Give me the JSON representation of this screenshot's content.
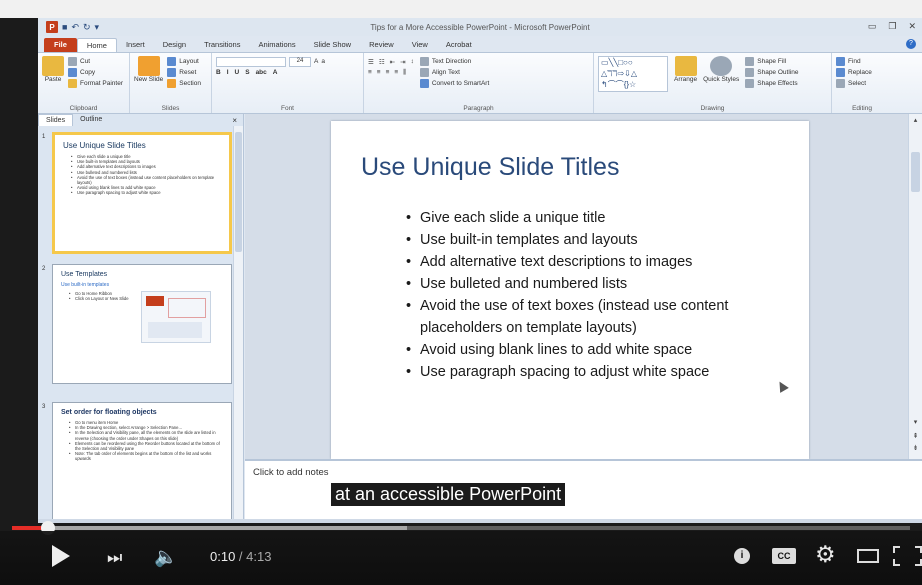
{
  "window": {
    "title": "Tips for a More Accessible PowerPoint - Microsoft PowerPoint",
    "logo": "P"
  },
  "tabs": [
    "File",
    "Home",
    "Insert",
    "Design",
    "Transitions",
    "Animations",
    "Slide Show",
    "Review",
    "View",
    "Acrobat"
  ],
  "ribbon": {
    "clipboard": {
      "paste": "Paste",
      "cut": "Cut",
      "copy": "Copy",
      "format_painter": "Format Painter",
      "label": "Clipboard"
    },
    "slides": {
      "new_slide": "New Slide",
      "layout": "Layout",
      "reset": "Reset",
      "section": "Section",
      "label": "Slides"
    },
    "font": {
      "size": "24",
      "label": "Font"
    },
    "paragraph": {
      "text_direction": "Text Direction",
      "align_text": "Align Text",
      "convert_smartart": "Convert to SmartArt",
      "label": "Paragraph"
    },
    "drawing": {
      "arrange": "Arrange",
      "quick_styles": "Quick Styles",
      "shape_fill": "Shape Fill",
      "shape_outline": "Shape Outline",
      "shape_effects": "Shape Effects",
      "label": "Drawing"
    },
    "editing": {
      "find": "Find",
      "replace": "Replace",
      "select": "Select",
      "label": "Editing"
    }
  },
  "left_panel": {
    "tabs": [
      "Slides",
      "Outline"
    ],
    "close": "×",
    "thumbnails": [
      {
        "num": "1",
        "title": "Use Unique Slide Titles",
        "bullets": [
          "Give each slide a unique title",
          "Use built-in templates and layouts",
          "Add alternative text descriptions to images",
          "Use bulleted and numbered lists",
          "Avoid the use of text boxes (instead use content placeholders on template layouts)",
          "Avoid using blank lines to add white space",
          "Use paragraph spacing to adjust white space"
        ]
      },
      {
        "num": "2",
        "title": "Use Templates",
        "subtitle": "Use built-in templates",
        "bullets": [
          "Go to Home Ribbon",
          "Click on Layout or New Slide"
        ]
      },
      {
        "num": "3",
        "title": "Set order for floating objects",
        "bullets": [
          "Go to menu item Home",
          "In the Drawing section, select Arrange > Selection Pane...",
          "In the Selection and Visibility pane, all the elements on the slide are listed in reverse (choosing the order under Shapes on this slide)",
          "Elements can be reordered using the Reorder buttons located at the bottom of the Selection and Visibility pane",
          "Note: The tab order of elements begins at the bottom of the list and works upwards"
        ]
      }
    ]
  },
  "slide": {
    "title": "Use Unique Slide Titles",
    "bullets": [
      "Give each slide a unique title",
      "Use built-in templates and layouts",
      "Add alternative text descriptions to images",
      "Use bulleted and numbered lists",
      "Avoid the use of text boxes (instead use content placeholders on template layouts)",
      "Avoid using blank lines to add white space",
      "Use paragraph spacing to adjust white space"
    ]
  },
  "notes": {
    "placeholder": "Click to add notes"
  },
  "caption": "at an accessible PowerPoint",
  "player": {
    "current_time": "0:10",
    "separator": " / ",
    "duration": "4:13",
    "played_fraction": 0.04,
    "loaded_fraction": 0.44,
    "cc_label": "CC",
    "info_label": "i",
    "icons": {
      "play": "play-icon",
      "next": "next-icon",
      "volume": "volume-icon",
      "info": "info-icon",
      "cc": "captions-icon",
      "settings": "gear-icon",
      "theater": "theater-mode-icon",
      "fullscreen": "fullscreen-icon"
    },
    "colors": {
      "played": "#e52d27"
    }
  }
}
